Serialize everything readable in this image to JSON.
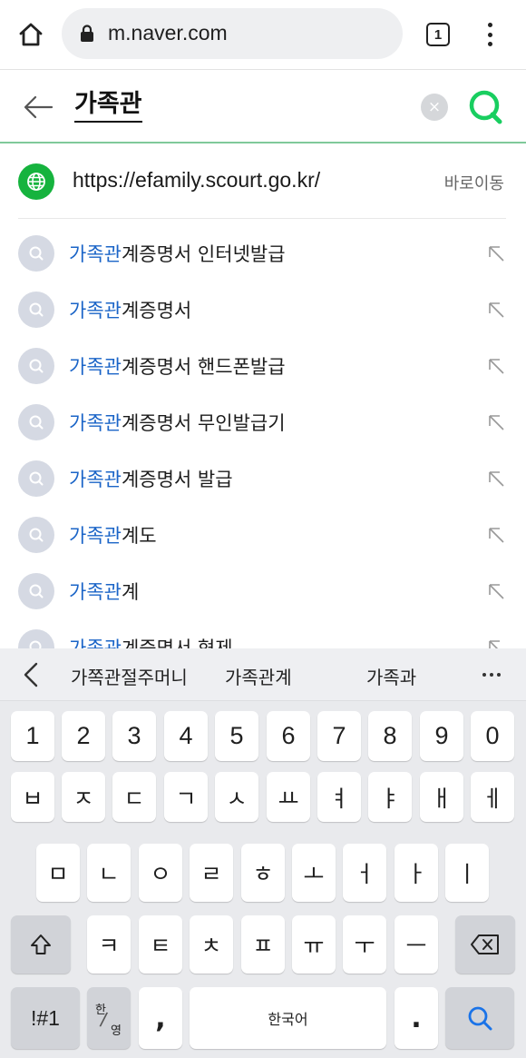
{
  "browser": {
    "url": "m.naver.com",
    "tab_count": "1"
  },
  "search": {
    "query": "가족관",
    "clear_label": "×"
  },
  "direct_link": {
    "url": "https://efamily.scourt.go.kr/",
    "action_label": "바로이동"
  },
  "suggestions": [
    {
      "highlight": "가족관",
      "rest": "계증명서 인터넷발급"
    },
    {
      "highlight": "가족관",
      "rest": "계증명서"
    },
    {
      "highlight": "가족관",
      "rest": "계증명서 핸드폰발급"
    },
    {
      "highlight": "가족관",
      "rest": "계증명서 무인발급기"
    },
    {
      "highlight": "가족관",
      "rest": "계증명서 발급"
    },
    {
      "highlight": "가족관",
      "rest": "계도"
    },
    {
      "highlight": "가족관",
      "rest": "계"
    },
    {
      "highlight": "가족관",
      "rest": "계증명서 형제"
    }
  ],
  "keyboard": {
    "predictions": [
      "가쪽관절주머니",
      "가족관계",
      "가족과"
    ],
    "number_row": [
      "1",
      "2",
      "3",
      "4",
      "5",
      "6",
      "7",
      "8",
      "9",
      "0"
    ],
    "row1": [
      "ㅂ",
      "ㅈ",
      "ㄷ",
      "ㄱ",
      "ㅅ",
      "ㅛ",
      "ㅕ",
      "ㅑ",
      "ㅐ",
      "ㅔ"
    ],
    "row2": [
      "ㅁ",
      "ㄴ",
      "ㅇ",
      "ㄹ",
      "ㅎ",
      "ㅗ",
      "ㅓ",
      "ㅏ",
      "ㅣ"
    ],
    "row3": [
      "ㅋ",
      "ㅌ",
      "ㅊ",
      "ㅍ",
      "ㅠ",
      "ㅜ",
      "ㅡ"
    ],
    "symbols_label": "!#1",
    "lang_top": "한",
    "lang_bottom": "영",
    "comma_label": ",",
    "space_label": "한국어",
    "period_label": "."
  },
  "colors": {
    "highlight": "#1a64c7",
    "naver_green": "#03c75a",
    "search_accent": "#19ce60"
  }
}
